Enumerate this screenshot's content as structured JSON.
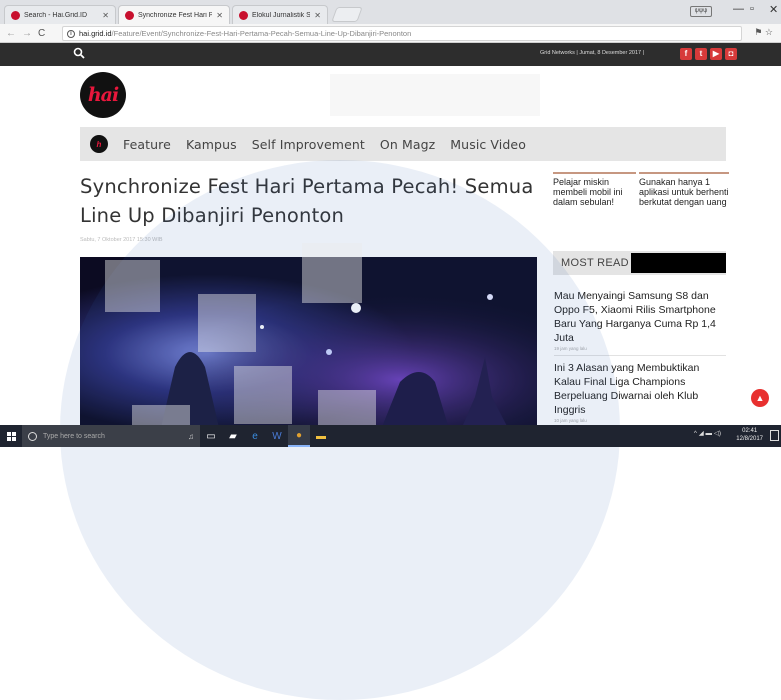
{
  "browser": {
    "tabs": [
      {
        "label": "Search - Hai.Grid.ID",
        "active": false
      },
      {
        "label": "Synchronize Fest Hari Pe",
        "active": true
      },
      {
        "label": "Elokul Jurnalistik Sekolah",
        "active": false
      }
    ],
    "user_badge": "ψψψ",
    "url_host": "hai.grid.id",
    "url_path": "/Feature/Event/Synchronize-Fest-Hari-Pertama-Pecah-Semua-Line-Up-Dibanjiri-Penonton"
  },
  "site": {
    "network_info": "Grid Networks | Jumat, 8 Desember 2017 |",
    "logo_text": "hai",
    "nav": [
      "Feature",
      "Kampus",
      "Self Improvement",
      "On Magz",
      "Music Video"
    ]
  },
  "article": {
    "title": "Synchronize Fest Hari Pertama Pecah! Semua Line Up Dibanjiri Penonton",
    "date": "Sabtu, 7 Oktober 2017 15:30 WIB"
  },
  "sidebar": {
    "cards": [
      "Pelajar miskin membeli mobil ini dalam sebulan!",
      "Gunakan hanya 1 aplikasi untuk berhenti berkutat dengan uang"
    ],
    "most_read_label": "MOST READ",
    "items": [
      {
        "title": "Mau Menyaingi Samsung S8 dan Oppo F5, Xiaomi Rilis Smartphone Baru Yang Harganya Cuma Rp 1,4 Juta",
        "time": "19 jam yang lalu"
      },
      {
        "title": "Ini 3 Alasan yang Membuktikan Kalau Final Liga Champions Berpeluang Diwarnai oleh Klub Inggris",
        "time": "10 jam yang lalu"
      }
    ]
  },
  "taskbar": {
    "search_placeholder": "Type here to search",
    "time": "02:41",
    "date": "12/8/2017"
  },
  "colors": {
    "brand_red": "#e8173c",
    "topbar": "#2d2d2d",
    "taskbar": "#1f2430"
  }
}
